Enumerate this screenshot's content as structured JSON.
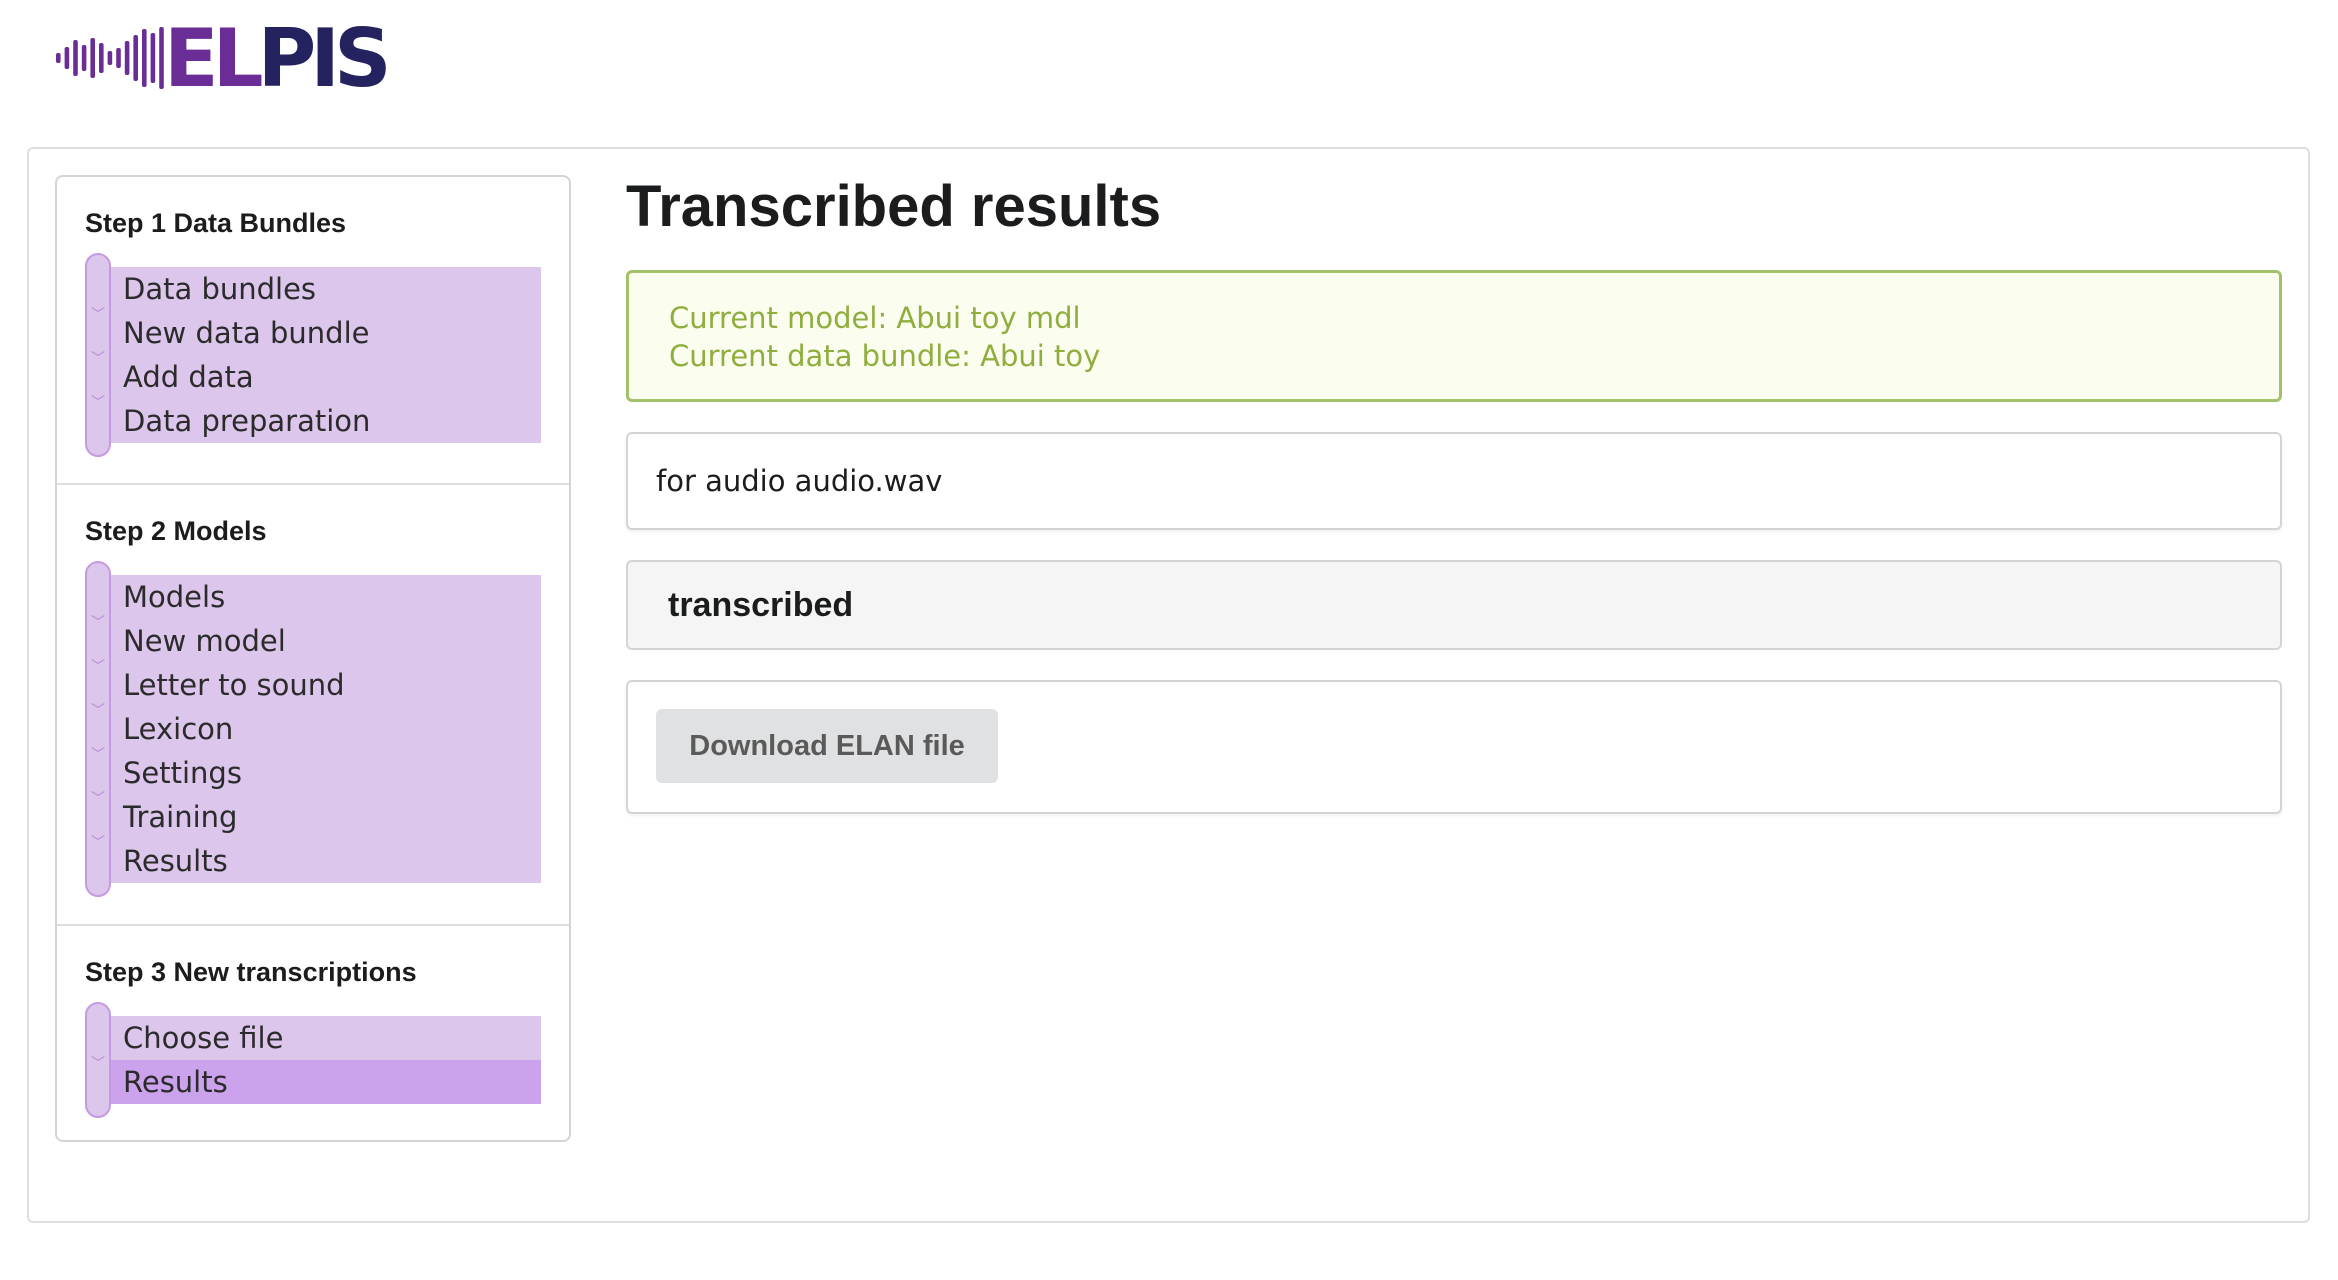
{
  "logo": {
    "word_prefix": "EL",
    "word_suffix": "PIS",
    "colors": {
      "dark": "#24235f",
      "purple": "#6a2d96"
    }
  },
  "sidebar": {
    "steps": [
      {
        "title": "Step 1 Data Bundles",
        "items": [
          {
            "label": "Data bundles"
          },
          {
            "label": "New data bundle"
          },
          {
            "label": "Add data"
          },
          {
            "label": "Data preparation"
          }
        ]
      },
      {
        "title": "Step 2 Models",
        "items": [
          {
            "label": "Models"
          },
          {
            "label": "New model"
          },
          {
            "label": "Letter to sound"
          },
          {
            "label": "Lexicon"
          },
          {
            "label": "Settings"
          },
          {
            "label": "Training"
          },
          {
            "label": "Results"
          }
        ]
      },
      {
        "title": "Step 3 New transcriptions",
        "items": [
          {
            "label": "Choose file"
          },
          {
            "label": "Results",
            "active": true
          }
        ]
      }
    ],
    "colors": {
      "item_bg": "#dcc6ec",
      "active_bg": "#cba3ec"
    }
  },
  "main": {
    "title": "Transcribed results",
    "current_model": "Current model: Abui toy mdl",
    "current_bundle": "Current data bundle: Abui toy",
    "audio_text": "for audio audio.wav",
    "transcribed_label": "transcribed",
    "download_label": "Download ELAN file",
    "colors": {
      "info_green": "#8fae3e",
      "info_border": "#a3c168"
    }
  }
}
